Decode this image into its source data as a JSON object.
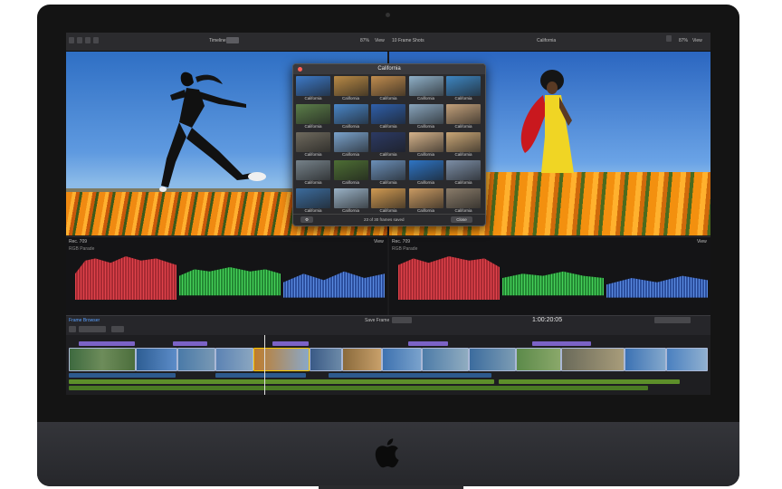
{
  "toolbar": {
    "timeline_label": "Timeline",
    "zoom_left": "87%",
    "view_left": "View",
    "browser_info": "10 Frame Shots",
    "viewer_title": "California",
    "zoom_right": "87%",
    "view_right": "View"
  },
  "scopes": {
    "left_label": "Rec. 709",
    "left_view": "View",
    "right_label": "Rec. 709",
    "right_view": "View",
    "left_sub": "RGB Parade",
    "right_sub": "RGB Parade"
  },
  "timeline": {
    "project_label": "Frame Browser",
    "save_label": "Save Frame",
    "timecode": "1:00:20:05"
  },
  "library": {
    "title": "California",
    "caption": "California",
    "status": "23 of 30 frames saved",
    "close_label": "Close",
    "settings_icon": "gear-icon",
    "thumbs": [
      "#3d7ac9",
      "#b98a46",
      "#c08c4e",
      "#8fb0c8",
      "#3e86c2",
      "#5c7e4a",
      "#4a86c8",
      "#2f5faa",
      "#88a4bc",
      "#c2a07a",
      "#6f6a5e",
      "#7aa2cc",
      "#2c3a64",
      "#d4b28a",
      "#c9a676",
      "#76828a",
      "#4d6e34",
      "#6b8fb8",
      "#2e74c4",
      "#7c8ea6",
      "#3c6c9e",
      "#9ab2c6",
      "#d09a52",
      "#c99a62",
      "#8a7c6a"
    ]
  },
  "colors": {
    "accent_yellow": "#f5c400",
    "clip_blue": "#aab8d6",
    "purple_title": "#7b63c6",
    "green_audio": "#5d8f2a"
  }
}
